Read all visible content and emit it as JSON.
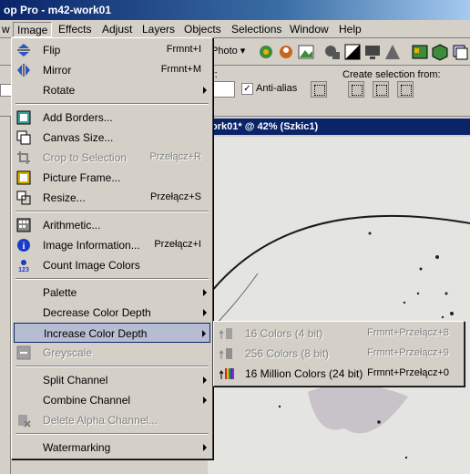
{
  "window": {
    "title": "op Pro - m42-work01"
  },
  "menubar": [
    {
      "label": "w"
    },
    {
      "label": "Image"
    },
    {
      "label": "Effects"
    },
    {
      "label": "Adjust"
    },
    {
      "label": "Layers"
    },
    {
      "label": "Objects"
    },
    {
      "label": "Selections"
    },
    {
      "label": "Window"
    },
    {
      "label": "Help"
    }
  ],
  "toolbar": {
    "photo_label": "Photo ▾"
  },
  "toolbar2": {
    "partial_label": "r:",
    "antialias_label": "Anti-alias",
    "create_selection_label": "Create selection from:"
  },
  "document": {
    "title": "ork01* @  42% (Szkic1)"
  },
  "image_menu": [
    {
      "label": "Flip",
      "shortcut": "Frmnt+I"
    },
    {
      "label": "Mirror",
      "shortcut": "Frmnt+M"
    },
    {
      "label": "Rotate",
      "shortcut": ""
    },
    {
      "label": "Add Borders...",
      "shortcut": ""
    },
    {
      "label": "Canvas Size...",
      "shortcut": ""
    },
    {
      "label": "Crop to Selection",
      "shortcut": "Przełącz+R"
    },
    {
      "label": "Picture Frame...",
      "shortcut": ""
    },
    {
      "label": "Resize...",
      "shortcut": "Przełącz+S"
    },
    {
      "label": "Arithmetic...",
      "shortcut": ""
    },
    {
      "label": "Image Information...",
      "shortcut": "Przełącz+I"
    },
    {
      "label": "Count Image Colors",
      "shortcut": ""
    },
    {
      "label": "Palette",
      "shortcut": ""
    },
    {
      "label": "Decrease Color Depth",
      "shortcut": ""
    },
    {
      "label": "Increase Color Depth",
      "shortcut": ""
    },
    {
      "label": "Greyscale",
      "shortcut": ""
    },
    {
      "label": "Split Channel",
      "shortcut": ""
    },
    {
      "label": "Combine Channel",
      "shortcut": ""
    },
    {
      "label": "Delete Alpha Channel...",
      "shortcut": ""
    },
    {
      "label": "Watermarking",
      "shortcut": ""
    }
  ],
  "submenu": [
    {
      "label": "16 Colors (4 bit)",
      "shortcut": "Frmnt+Przełącz+8"
    },
    {
      "label": "256 Colors (8 bit)",
      "shortcut": "Frmnt+Przełącz+9"
    },
    {
      "label": "16 Million Colors (24 bit)",
      "shortcut": "Frmnt+Przełącz+0"
    }
  ],
  "colors": {
    "menu_bg": "#d4d0c8",
    "highlight": "#b6bdd2",
    "title_bar": "#0a246a"
  }
}
